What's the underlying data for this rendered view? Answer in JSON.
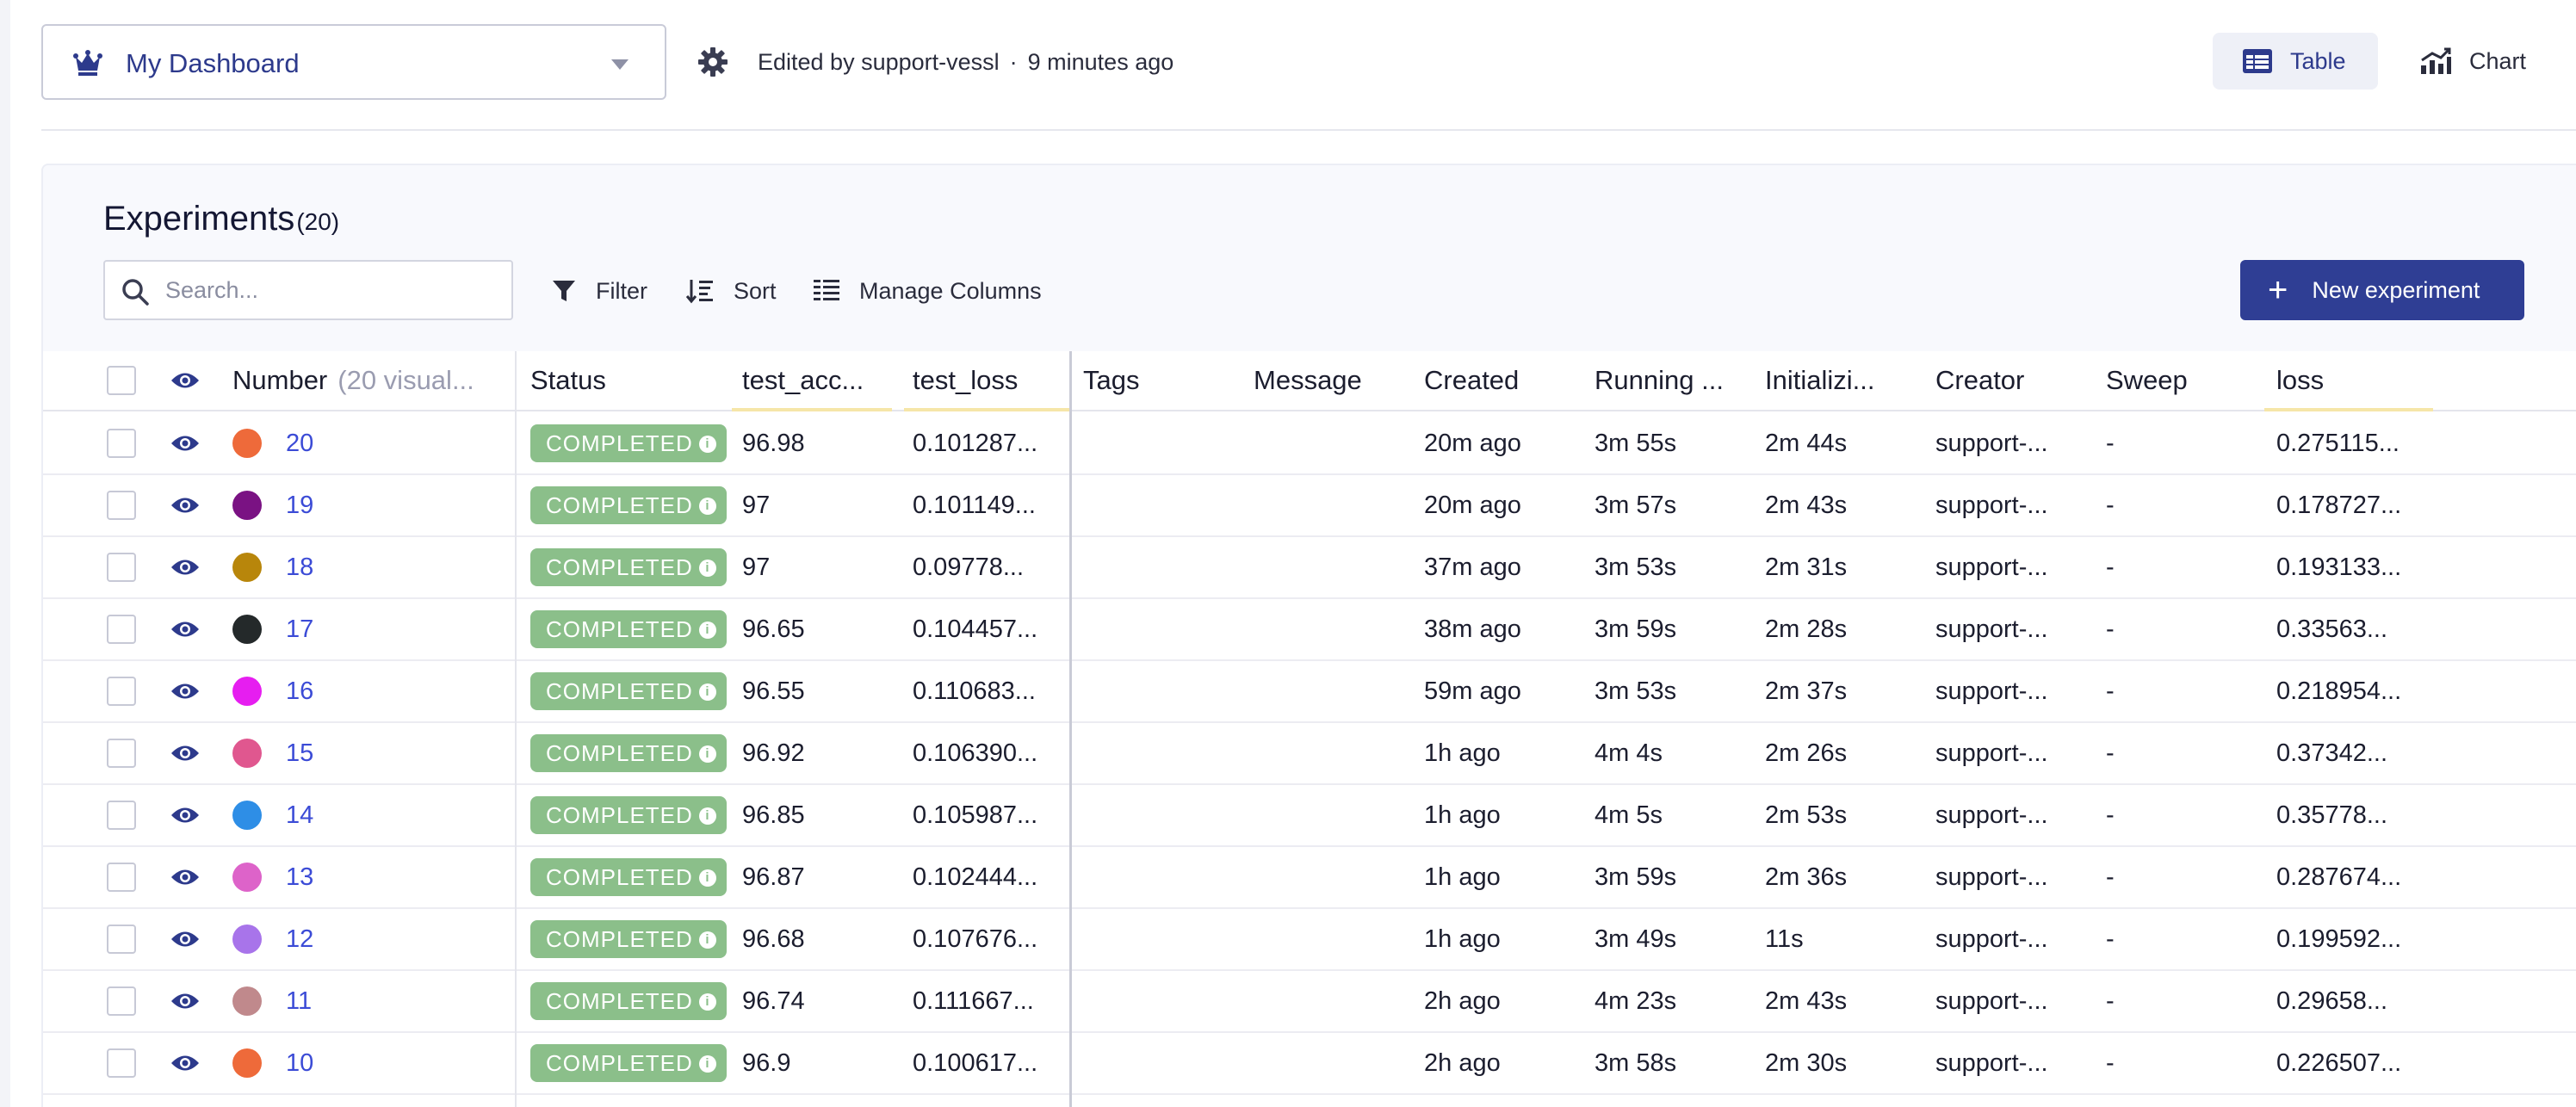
{
  "header": {
    "dashboard_name": "My Dashboard",
    "edited_by": "Edited by support-vessl",
    "edited_sep": "·",
    "edited_time": "9 minutes ago",
    "view_table_label": "Table",
    "view_chart_label": "Chart"
  },
  "experiments": {
    "title": "Experiments",
    "count": "(20)",
    "search_placeholder": "Search...",
    "filter_label": "Filter",
    "sort_label": "Sort",
    "manage_columns_label": "Manage Columns",
    "new_button_label": "New experiment"
  },
  "table": {
    "columns": {
      "number": "Number",
      "number_sub": "(20 visual...",
      "status": "Status",
      "test_acc": "test_acc...",
      "test_loss": "test_loss",
      "tags": "Tags",
      "message": "Message",
      "created": "Created",
      "running": "Running ...",
      "initializing": "Initializi...",
      "creator": "Creator",
      "sweep": "Sweep",
      "loss": "loss"
    },
    "column_highlight_color": "#f6e6a8",
    "status_color": "#8bbf8a",
    "rows": [
      {
        "number": "20",
        "color": "#ee6a3a",
        "status": "COMPLETED",
        "test_acc": "96.98",
        "test_loss": "0.101287...",
        "tags": "",
        "message": "",
        "created": "20m ago",
        "running": "3m 55s",
        "initializing": "2m 44s",
        "creator": "support-...",
        "sweep": "-",
        "loss": "0.275115..."
      },
      {
        "number": "19",
        "color": "#7a1283",
        "status": "COMPLETED",
        "test_acc": "97",
        "test_loss": "0.101149...",
        "tags": "",
        "message": "",
        "created": "20m ago",
        "running": "3m 57s",
        "initializing": "2m 43s",
        "creator": "support-...",
        "sweep": "-",
        "loss": "0.178727..."
      },
      {
        "number": "18",
        "color": "#b8860b",
        "status": "COMPLETED",
        "test_acc": "97",
        "test_loss": "0.09778...",
        "tags": "",
        "message": "",
        "created": "37m ago",
        "running": "3m 53s",
        "initializing": "2m 31s",
        "creator": "support-...",
        "sweep": "-",
        "loss": "0.193133..."
      },
      {
        "number": "17",
        "color": "#24292a",
        "status": "COMPLETED",
        "test_acc": "96.65",
        "test_loss": "0.104457...",
        "tags": "",
        "message": "",
        "created": "38m ago",
        "running": "3m 59s",
        "initializing": "2m 28s",
        "creator": "support-...",
        "sweep": "-",
        "loss": "0.33563..."
      },
      {
        "number": "16",
        "color": "#e61ef0",
        "status": "COMPLETED",
        "test_acc": "96.55",
        "test_loss": "0.110683...",
        "tags": "",
        "message": "",
        "created": "59m ago",
        "running": "3m 53s",
        "initializing": "2m 37s",
        "creator": "support-...",
        "sweep": "-",
        "loss": "0.218954..."
      },
      {
        "number": "15",
        "color": "#e0578f",
        "status": "COMPLETED",
        "test_acc": "96.92",
        "test_loss": "0.106390...",
        "tags": "",
        "message": "",
        "created": "1h ago",
        "running": "4m 4s",
        "initializing": "2m 26s",
        "creator": "support-...",
        "sweep": "-",
        "loss": "0.37342..."
      },
      {
        "number": "14",
        "color": "#2e8ee6",
        "status": "COMPLETED",
        "test_acc": "96.85",
        "test_loss": "0.105987...",
        "tags": "",
        "message": "",
        "created": "1h ago",
        "running": "4m 5s",
        "initializing": "2m 53s",
        "creator": "support-...",
        "sweep": "-",
        "loss": "0.35778..."
      },
      {
        "number": "13",
        "color": "#dd63c9",
        "status": "COMPLETED",
        "test_acc": "96.87",
        "test_loss": "0.102444...",
        "tags": "",
        "message": "",
        "created": "1h ago",
        "running": "3m 59s",
        "initializing": "2m 36s",
        "creator": "support-...",
        "sweep": "-",
        "loss": "0.287674..."
      },
      {
        "number": "12",
        "color": "#a874ea",
        "status": "COMPLETED",
        "test_acc": "96.68",
        "test_loss": "0.107676...",
        "tags": "",
        "message": "",
        "created": "1h ago",
        "running": "3m 49s",
        "initializing": "11s",
        "creator": "support-...",
        "sweep": "-",
        "loss": "0.199592..."
      },
      {
        "number": "11",
        "color": "#c0898c",
        "status": "COMPLETED",
        "test_acc": "96.74",
        "test_loss": "0.111667...",
        "tags": "",
        "message": "",
        "created": "2h ago",
        "running": "4m 23s",
        "initializing": "2m 43s",
        "creator": "support-...",
        "sweep": "-",
        "loss": "0.29658..."
      },
      {
        "number": "10",
        "color": "#ee6a3a",
        "status": "COMPLETED",
        "test_acc": "96.9",
        "test_loss": "0.100617...",
        "tags": "",
        "message": "",
        "created": "2h ago",
        "running": "3m 58s",
        "initializing": "2m 30s",
        "creator": "support-...",
        "sweep": "-",
        "loss": "0.226507..."
      }
    ]
  }
}
